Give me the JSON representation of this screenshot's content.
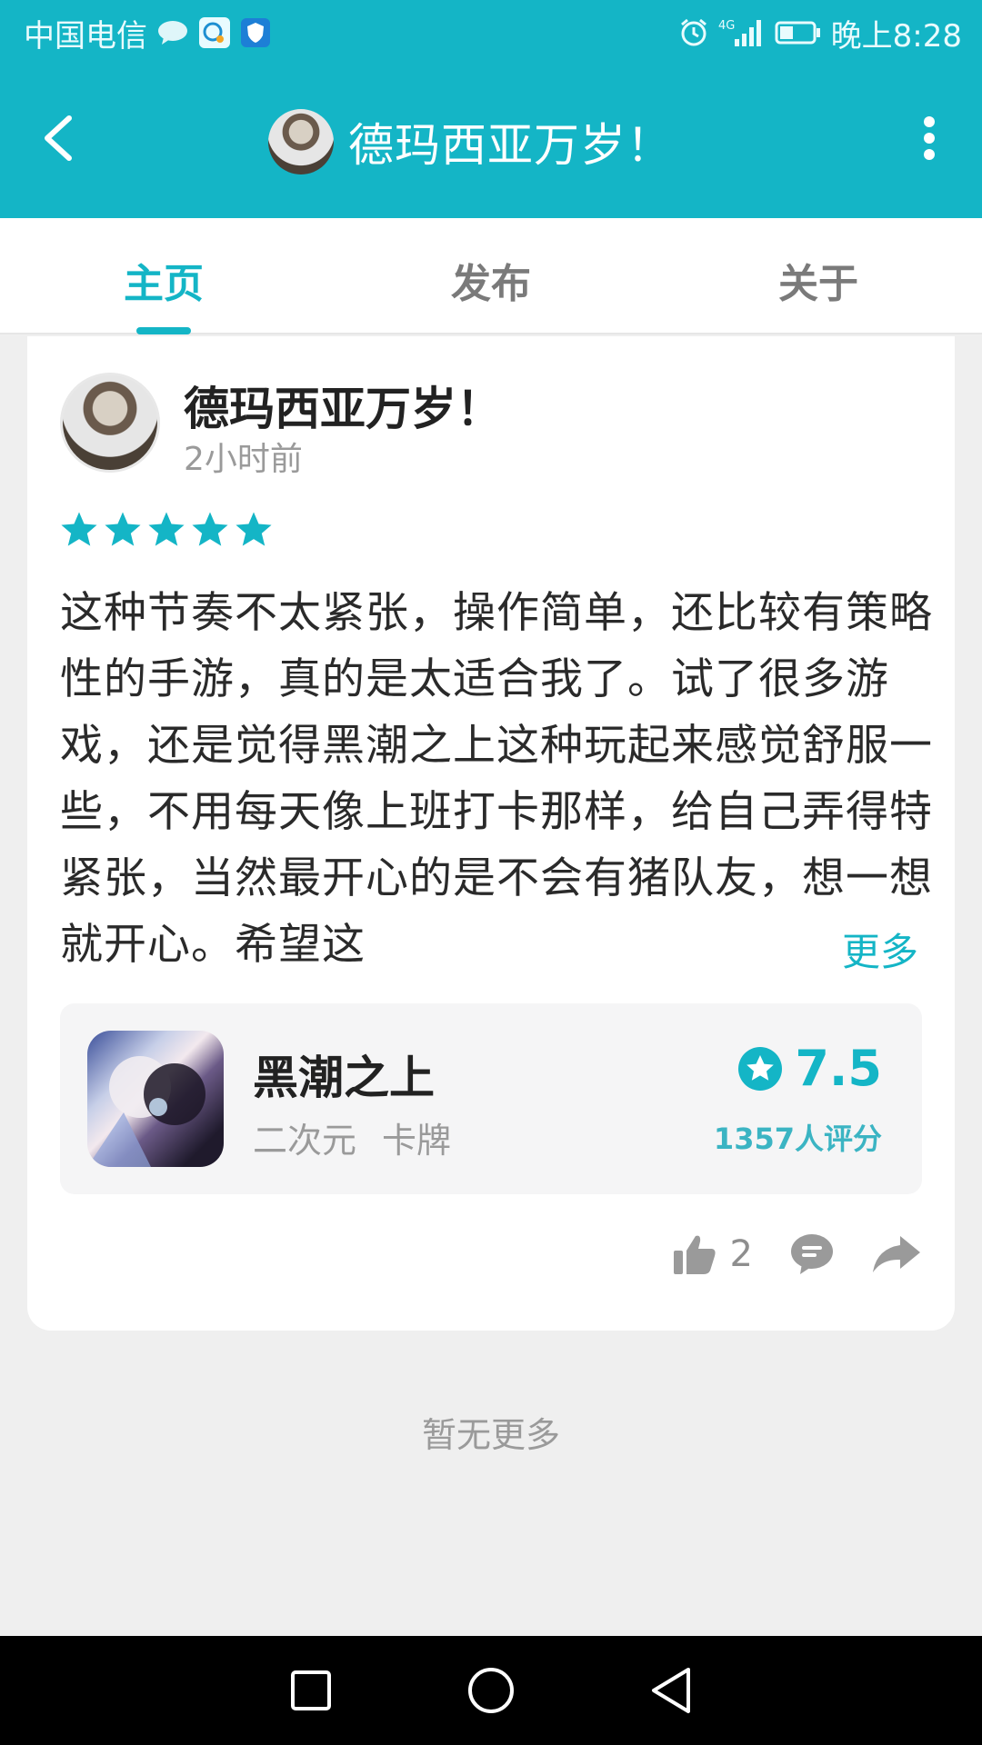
{
  "status_bar": {
    "carrier": "中国电信",
    "time": "晚上8:28",
    "network": "4G",
    "icons": [
      "chat-icon",
      "message-app-icon",
      "shield-icon",
      "alarm-icon",
      "signal-icon",
      "battery-icon"
    ]
  },
  "app_bar": {
    "title": "德玛西亚万岁！",
    "icons": [
      "back-arrow-icon",
      "more-vertical-icon"
    ]
  },
  "tabs": [
    {
      "label": "主页",
      "active": true
    },
    {
      "label": "发布",
      "active": false
    },
    {
      "label": "关于",
      "active": false
    }
  ],
  "post": {
    "author": "德玛西亚万岁！",
    "time": "2小时前",
    "rating_stars": 5,
    "text": "这种节奏不太紧张，操作简单，还比较有策略性的手游，真的是太适合我了。试了很多游戏，还是觉得黑潮之上这种玩起来感觉舒服一些，不用每天像上班打卡那样，给自己弄得特紧张，当然最开心的是不会有猪队友，想一想就开心。希望这",
    "more_label": "更多",
    "game": {
      "name": "黑潮之上",
      "tags": [
        "二次元",
        "卡牌"
      ],
      "score": "7.5",
      "rating_count": "1357人评分"
    },
    "actions": {
      "likes": "2",
      "icons": [
        "thumbs-up-icon",
        "comment-icon",
        "share-icon"
      ]
    }
  },
  "end_text": "暂无更多",
  "colors": {
    "accent": "#14b5c6",
    "background": "#efefef",
    "card": "#ffffff"
  },
  "nav_bar": {
    "icons": [
      "recents-square-icon",
      "home-circle-icon",
      "back-triangle-icon"
    ]
  }
}
